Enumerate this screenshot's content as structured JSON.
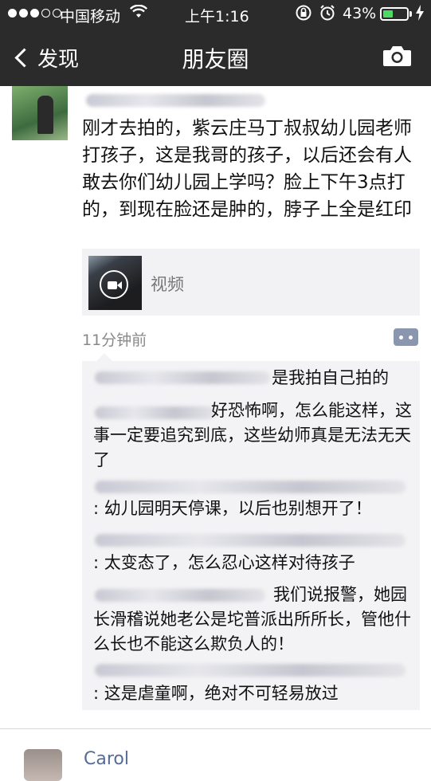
{
  "status_bar": {
    "carrier": "中国移动",
    "time": "上午1:16",
    "battery_percent": "43%",
    "battery_level": 0.43
  },
  "nav": {
    "back_label": "发现",
    "title": "朋友圈"
  },
  "post": {
    "text": "刚才去拍的，紫云庄马丁叔叔幼儿园老师打孩子，这是我哥的孩子，以后还会有人敢去你们幼儿园上学吗？脸上下午3点打的，到现在脸还是肿的，脖子上全是红印",
    "video_label": "视频",
    "time_ago": "11分钟前"
  },
  "comments": [
    {
      "text": "是我拍自己拍的"
    },
    {
      "text": "好恐怖啊，怎么能这样，这事一定要追究到底，这些幼师真是无法无天了"
    },
    {
      "text": ": 幼儿园明天停课，以后也别想开了！"
    },
    {
      "text": ": 太变态了，怎么忍心这样对待孩子"
    },
    {
      "text": "我们说报警，她园长滑稽说她老公是坨普派出所所长，管他什么长也不能这么欺负人的！"
    },
    {
      "text": ": 这是虐童啊，绝对不可轻易放过"
    }
  ],
  "next_post": {
    "name": "Carol"
  },
  "colors": {
    "nav_bg": "#2b2b2b",
    "link_blue": "#576b95",
    "battery_green": "#4cd964"
  }
}
